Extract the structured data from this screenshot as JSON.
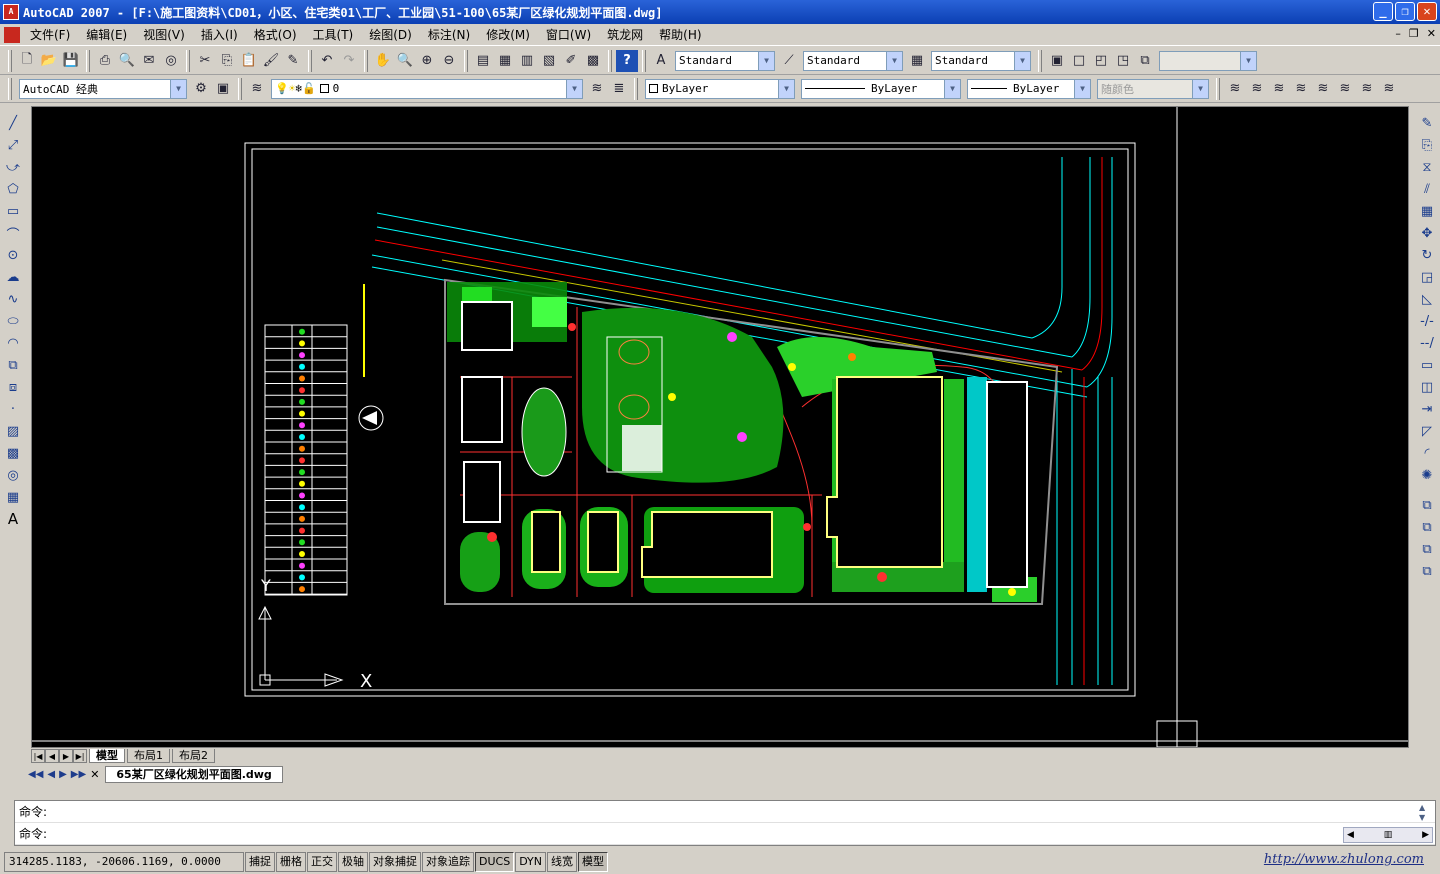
{
  "window": {
    "title": "AutoCAD 2007 - [F:\\施工图资料\\CD01，小区、住宅类01\\工厂、工业园\\51-100\\65某厂区绿化规划平面图.dwg]",
    "app_icon_text": "A"
  },
  "menu": {
    "items": [
      "文件(F)",
      "编辑(E)",
      "视图(V)",
      "插入(I)",
      "格式(O)",
      "工具(T)",
      "绘图(D)",
      "标注(N)",
      "修改(M)",
      "窗口(W)",
      "筑龙网",
      "帮助(H)"
    ]
  },
  "styles": {
    "text_style": "Standard",
    "dim_style": "Standard",
    "table_style": "Standard",
    "workspace": "AutoCAD 经典",
    "layer": "0",
    "color": "ByLayer",
    "linetype": "ByLayer",
    "lineweight": "ByLayer",
    "plotstyle": "随颜色"
  },
  "layout_tabs": [
    "模型",
    "布局1",
    "布局2"
  ],
  "active_tab": "模型",
  "document_tab": "65某厂区绿化规划平面图.dwg",
  "command": {
    "line1": "命令:",
    "line2": "命令:"
  },
  "status": {
    "coordinates": "314285.1183, -20606.1169, 0.0000",
    "buttons": [
      "捕捉",
      "栅格",
      "正交",
      "极轴",
      "对象捕捉",
      "对象追踪",
      "DUCS",
      "DYN",
      "线宽",
      "模型"
    ],
    "url": "http://www.zhulong.com"
  },
  "canvas": {
    "ucs_x": "X",
    "ucs_y": "Y",
    "background": "#000000"
  },
  "colors": {
    "titlebar": "#0b3fb3",
    "road_cyan": "#00ffff",
    "road_red": "#ff0000",
    "plant_green": "#00c800",
    "building_yellow": "#ffff80"
  },
  "icons": {
    "left": [
      "line-icon",
      "construction-line-icon",
      "polyline-icon",
      "polygon-icon",
      "rectangle-icon",
      "arc-icon",
      "circle-icon",
      "revision-cloud-icon",
      "spline-icon",
      "ellipse-icon",
      "ellipse-arc-icon",
      "insert-block-icon",
      "make-block-icon",
      "point-icon",
      "hatch-icon",
      "gradient-icon",
      "region-icon",
      "table-icon",
      "multiline-text-icon"
    ],
    "right": [
      "erase-icon",
      "copy-icon",
      "mirror-icon",
      "offset-icon",
      "array-icon",
      "move-icon",
      "rotate-icon",
      "scale-icon",
      "stretch-icon",
      "trim-icon",
      "extend-icon",
      "break-at-point-icon",
      "break-icon",
      "join-icon",
      "chamfer-icon",
      "fillet-icon",
      "explode-icon"
    ]
  }
}
